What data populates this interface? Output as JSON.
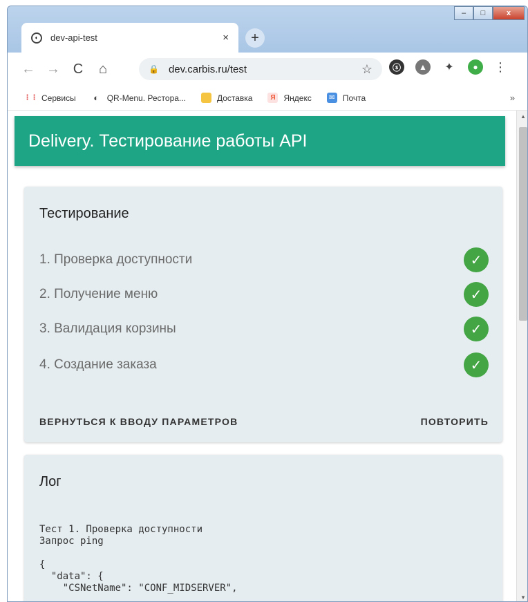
{
  "browser": {
    "tab": {
      "title": "dev-api-test",
      "close": "×"
    },
    "new_tab": "+",
    "nav": {
      "back": "←",
      "forward": "→",
      "reload": "C",
      "home": "⌂"
    },
    "address": {
      "url": "dev.carbis.ru/test",
      "bookmark_star": "☆"
    },
    "window_controls": {
      "minimize": "–",
      "maximize": "□",
      "close": "x"
    },
    "menu": "⋮",
    "bookmarks": [
      {
        "label": "Сервисы",
        "icon": "apps-grid-icon"
      },
      {
        "label": "QR-Menu. Рестора...",
        "icon": "globe-icon"
      },
      {
        "label": "Доставка",
        "icon": "folder-icon"
      },
      {
        "label": "Яндекс",
        "icon": "yandex-icon"
      },
      {
        "label": "Почта",
        "icon": "mail-icon"
      }
    ],
    "bookmarks_more": "»"
  },
  "app": {
    "title": "Delivery. Тестирование работы API",
    "colors": {
      "primary": "#1ea585",
      "card_bg": "#e5edf0",
      "success": "#43a544"
    }
  },
  "testing": {
    "title": "Тестирование",
    "steps": [
      {
        "label": "1. Проверка доступности",
        "status": "success"
      },
      {
        "label": "2. Получение меню",
        "status": "success"
      },
      {
        "label": "3. Валидация корзины",
        "status": "success"
      },
      {
        "label": "4. Создание заказа",
        "status": "success"
      }
    ],
    "back_button": "ВЕРНУТЬСЯ К ВВОДУ ПАРАМЕТРОВ",
    "repeat_button": "ПОВТОРИТЬ"
  },
  "log": {
    "title": "Лог",
    "content": "Тест 1. Проверка доступности\nЗапрос ping\n\n{\n  \"data\": {\n    \"CSNetName\": \"CONF_MIDSERVER\","
  }
}
